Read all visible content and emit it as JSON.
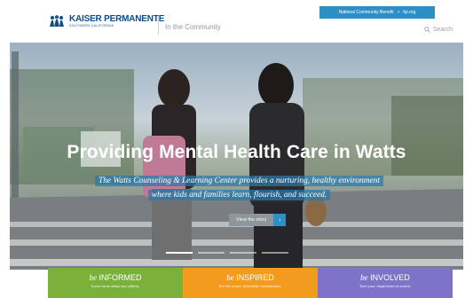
{
  "header": {
    "brand_name": "KAISER PERMANENTE",
    "brand_sub": "SOUTHERN CALIFORNIA",
    "section": "In the Community",
    "search_label": "Search",
    "top_links": [
      "National Community Benefit",
      "kp.org"
    ],
    "top_sep": "+"
  },
  "hero": {
    "title": "Providing Mental Health Care in Watts",
    "subtitle": "The Watts Counseling & Learning Center provides a nurturing, healthy environment where kids and families learn, flourish, and succeed.",
    "button_label": "View the story",
    "slides": 4,
    "active_slide": 1
  },
  "tiles": [
    {
      "prefix": "be",
      "word": "INFORMED",
      "tagline": "Learn more about our efforts.",
      "color": "#7ab13a"
    },
    {
      "prefix": "be",
      "word": "INSPIRED",
      "tagline": "See the power of healthy communities.",
      "color": "#f29b1d"
    },
    {
      "prefix": "be",
      "word": "INVOLVED",
      "tagline": "Turn your inspiration to action.",
      "color": "#7e72c9"
    }
  ],
  "colors": {
    "brand": "#0e4c8a",
    "accent": "#2d8fc4"
  }
}
